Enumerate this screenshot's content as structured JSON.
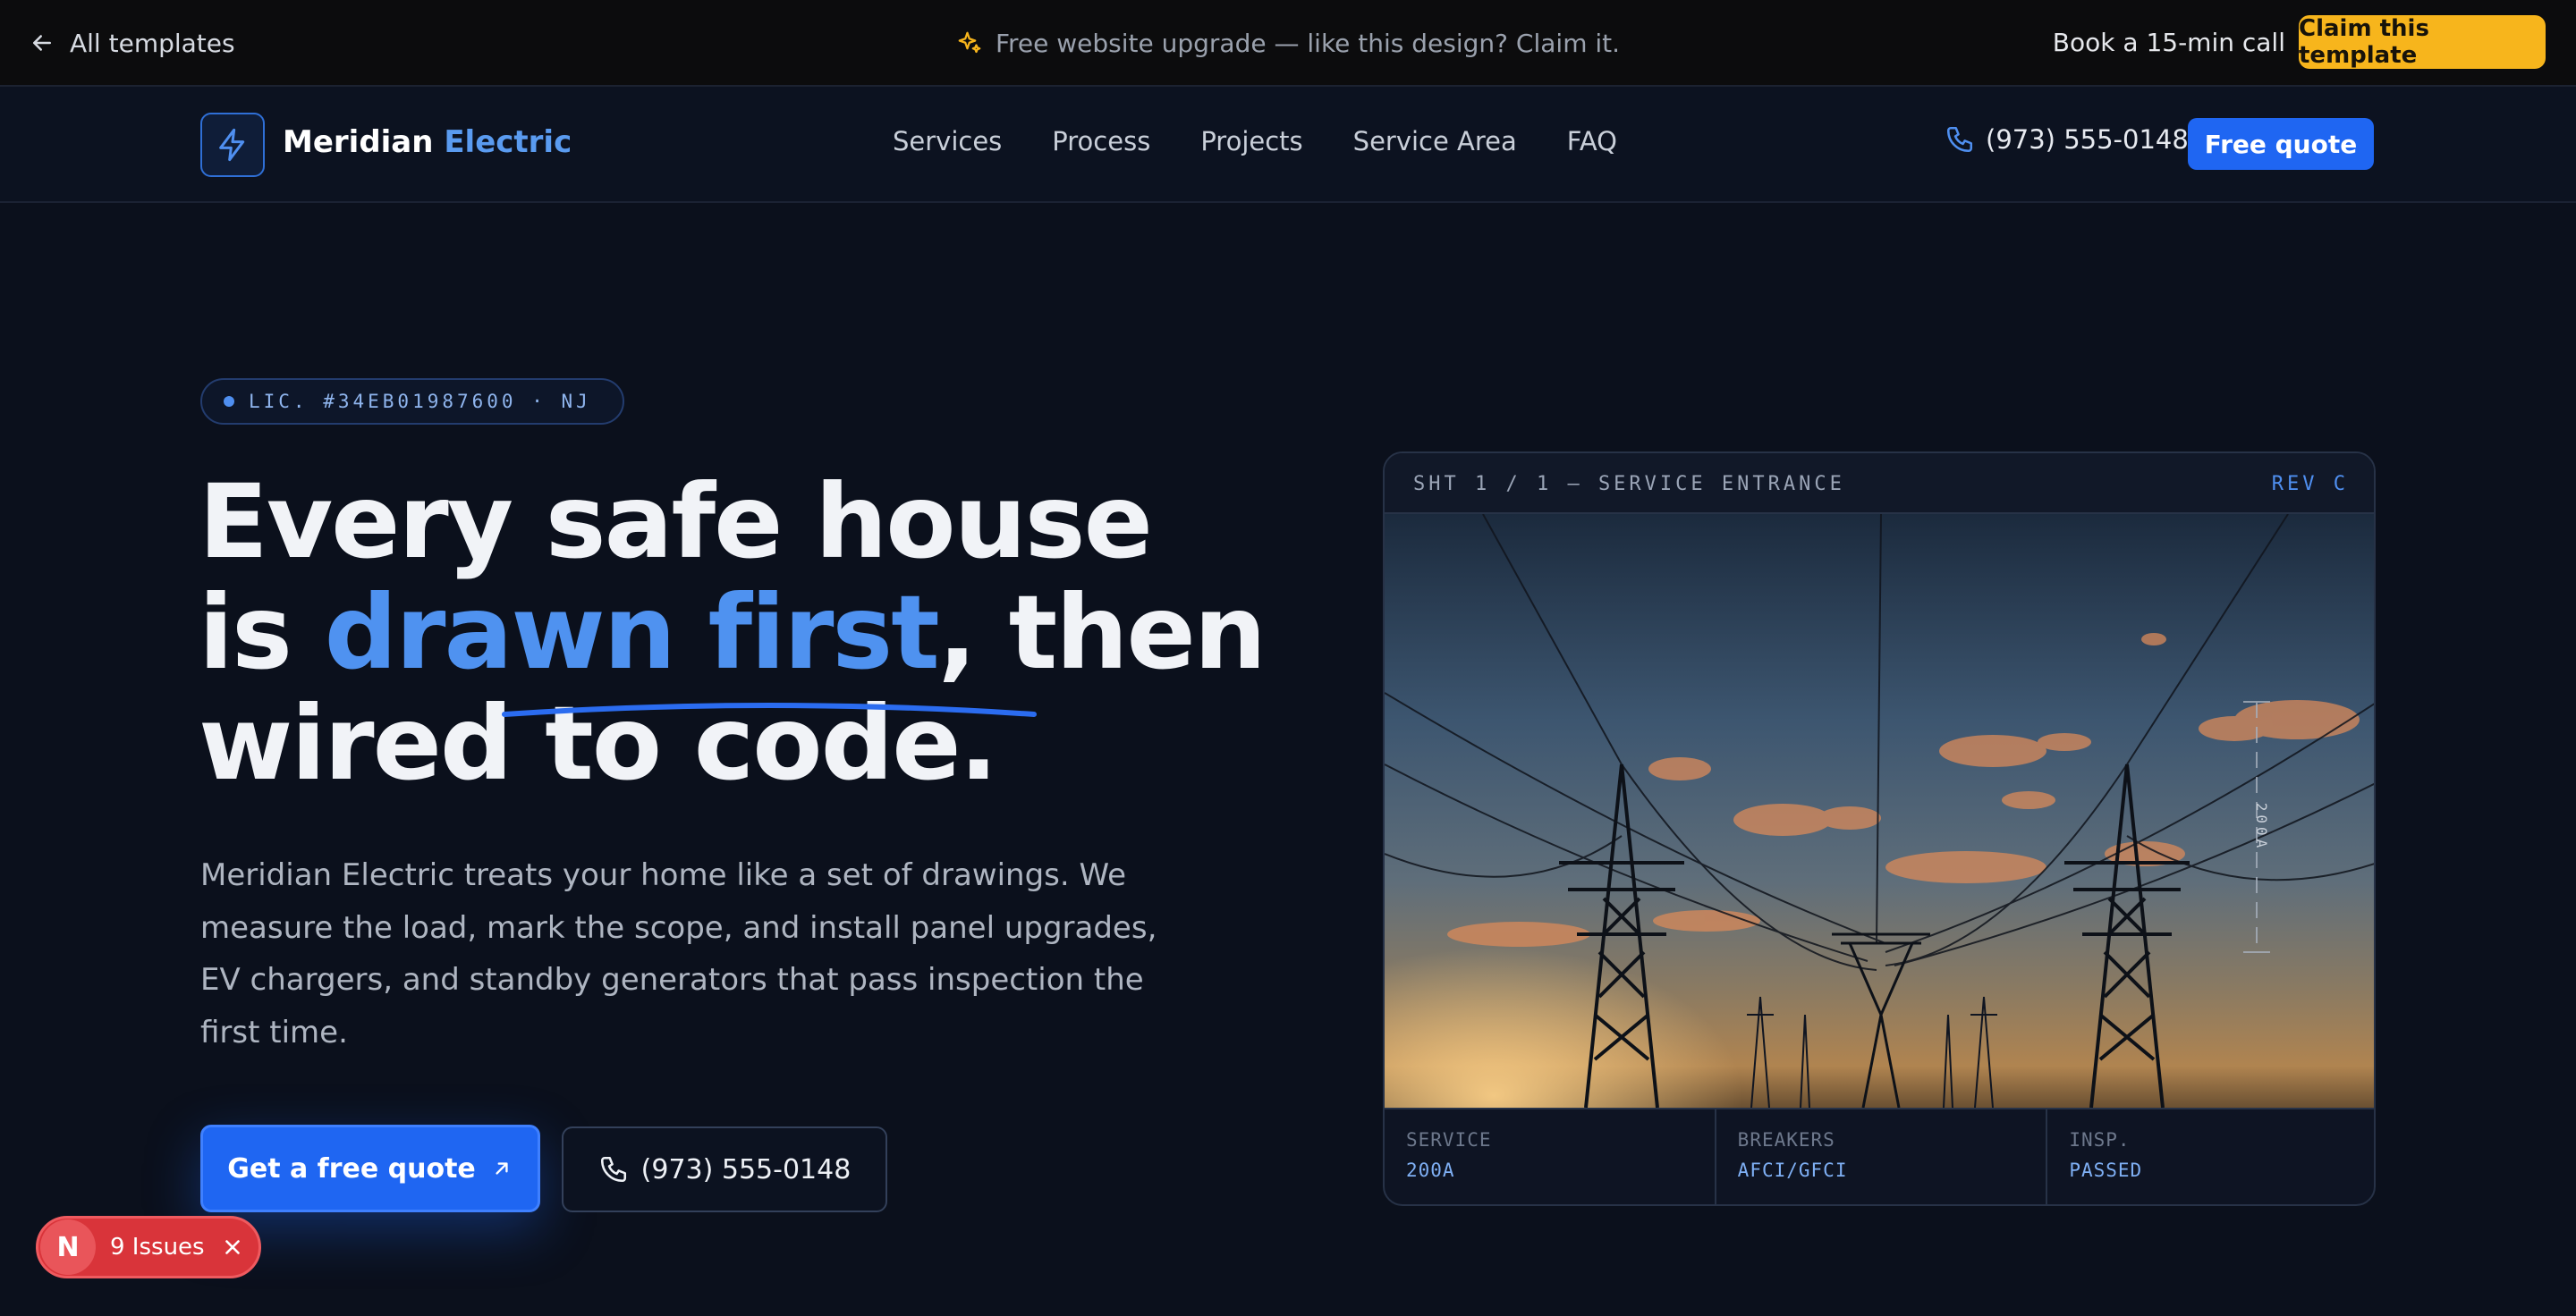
{
  "topbar": {
    "back_label": "All templates",
    "promo_text": "Free website upgrade — like this design? Claim it.",
    "call_label": "Book a 15-min call",
    "claim_label": "Claim this template",
    "claim_color": "#f7b51c"
  },
  "nav": {
    "brand_name": "Meridian",
    "brand_accent": "Electric",
    "links": [
      "Services",
      "Process",
      "Projects",
      "Service Area",
      "FAQ"
    ],
    "phone": "(973) 555-0148",
    "cta_label": "Free quote",
    "accent_color": "#1f66f2"
  },
  "hero": {
    "license_badge": "LIC. #34EB01987600 · NJ",
    "headline": {
      "line1": "Every safe house",
      "line2_pre": "is ",
      "line2_highlight": "drawn first",
      "line2_post": ", then",
      "line3": "wired to code."
    },
    "lede": "Meridian Electric treats your home like a set of drawings. We measure the load, mark the scope, and install panel upgrades, EV chargers, and standby generators that pass inspection the first time.",
    "primary_cta": "Get a free quote",
    "secondary_cta": "(973) 555-0148"
  },
  "sheet": {
    "title": "SHT 1 / 1 — SERVICE ENTRANCE",
    "revision": "REV C",
    "dimension_label": "200A",
    "footer": [
      {
        "label": "SERVICE",
        "value": "200A"
      },
      {
        "label": "BREAKERS",
        "value": "AFCI/GFCI"
      },
      {
        "label": "INSP.",
        "value": "PASSED"
      }
    ]
  },
  "issues_badge": {
    "icon_letter": "N",
    "label": "9 Issues",
    "color": "#d9343a"
  }
}
